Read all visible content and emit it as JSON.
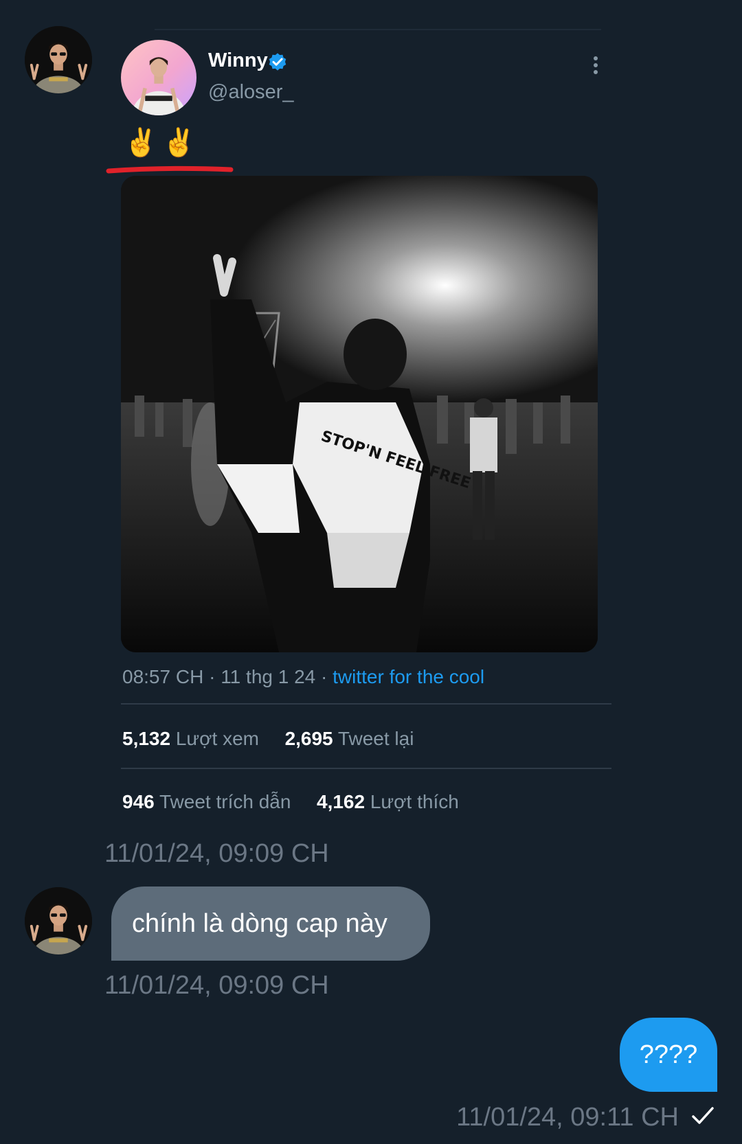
{
  "tweet": {
    "author_name": "Winny",
    "author_handle": "@aloser_",
    "text": "✌️✌️",
    "time": "08:57 CH",
    "date": "11 thg 1 24",
    "separator": "·",
    "source": "twitter for the cool",
    "stats_row1": [
      {
        "number": "5,132",
        "label": "Lượt xem"
      },
      {
        "number": "2,695",
        "label": "Tweet lại"
      }
    ],
    "stats_row2": [
      {
        "number": "946",
        "label": "Tweet trích dẫn"
      },
      {
        "number": "4,162",
        "label": "Lượt thích"
      }
    ],
    "photo_jacket_text": "STOP'N FEEL FREE"
  },
  "messages": [
    {
      "type": "shared_tweet",
      "timestamp": "11/01/24, 09:09 CH"
    },
    {
      "type": "received",
      "text": "chính là dòng cap này",
      "timestamp": "11/01/24, 09:09 CH"
    },
    {
      "type": "sent",
      "text": "????",
      "timestamp": "11/01/24, 09:11 CH"
    }
  ],
  "colors": {
    "background": "#15202b",
    "accent": "#1d9bf0",
    "received_bubble": "#5d6c7a",
    "underline_annotation": "#e0222a"
  },
  "icons": [
    "verified-badge-icon",
    "more-options-icon",
    "sent-check-icon"
  ]
}
